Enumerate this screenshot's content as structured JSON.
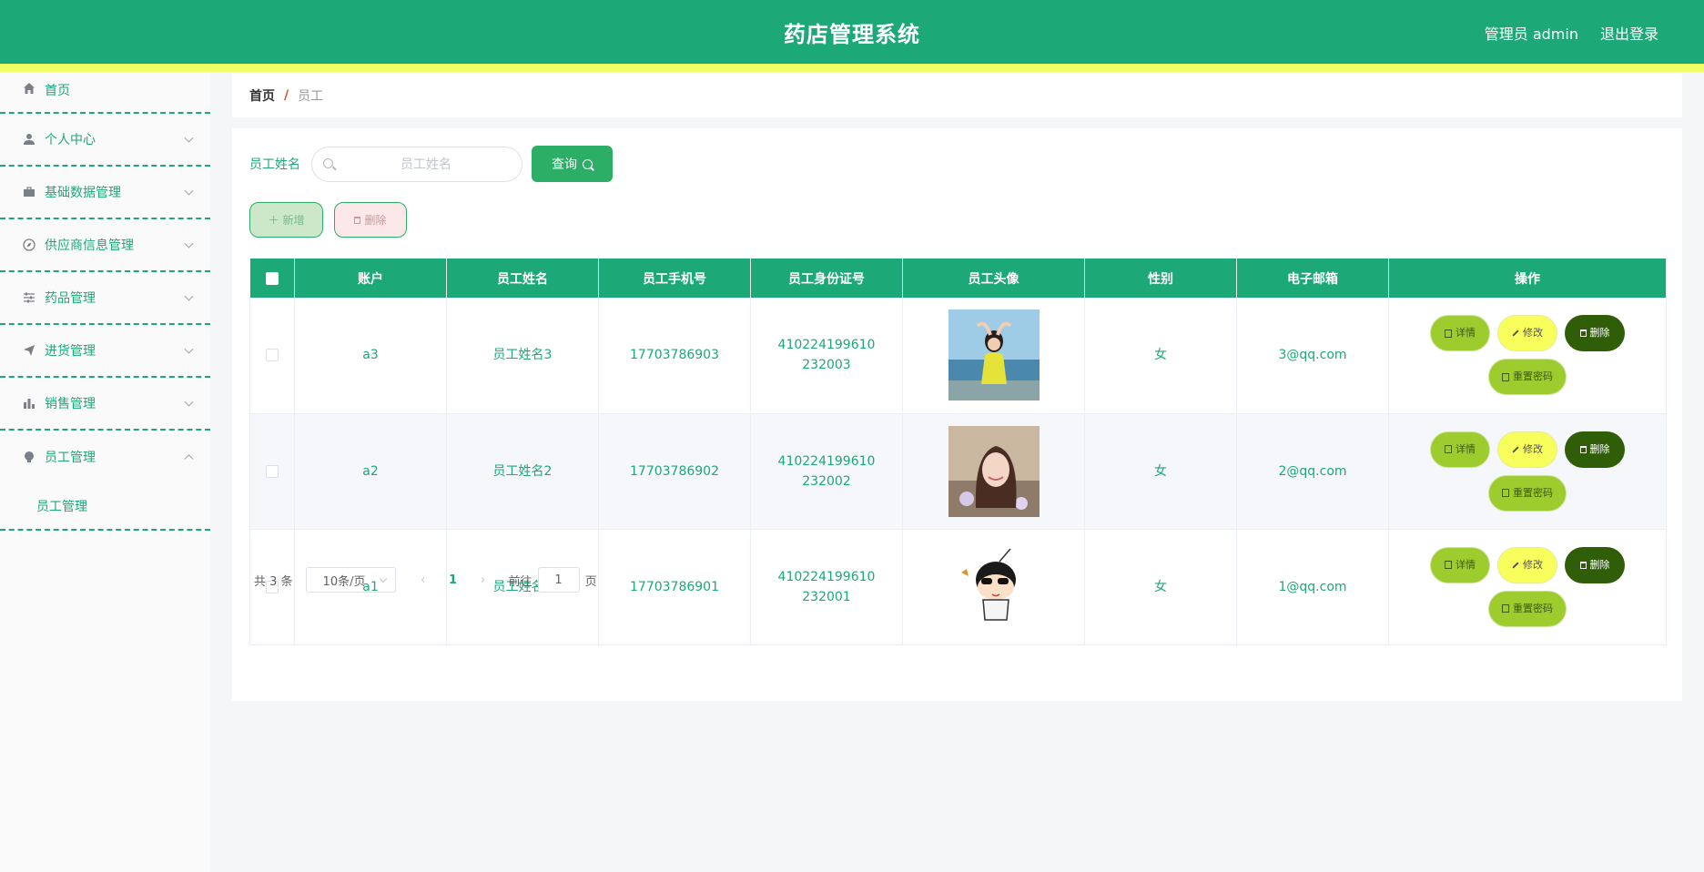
{
  "header": {
    "title": "药店管理系统",
    "user": "管理员 admin",
    "logout": "退出登录"
  },
  "sidebar": {
    "items": [
      {
        "label": "首页",
        "icon": "home-icon"
      },
      {
        "label": "个人中心",
        "icon": "user-icon"
      },
      {
        "label": "基础数据管理",
        "icon": "briefcase-icon"
      },
      {
        "label": "供应商信息管理",
        "icon": "compass-icon"
      },
      {
        "label": "药品管理",
        "icon": "sliders-icon"
      },
      {
        "label": "进货管理",
        "icon": "send-icon"
      },
      {
        "label": "销售管理",
        "icon": "bar-chart-icon"
      },
      {
        "label": "员工管理",
        "icon": "bulb-icon"
      }
    ],
    "submenu": "员工管理"
  },
  "breadcrumb": {
    "home": "首页",
    "separator": "/",
    "current": "员工"
  },
  "search": {
    "label": "员工姓名",
    "placeholder": "员工姓名",
    "button": "查询"
  },
  "actions": {
    "add": "新增",
    "delete": "删除"
  },
  "table": {
    "headers": [
      "账户",
      "员工姓名",
      "员工手机号",
      "员工身份证号",
      "员工头像",
      "性别",
      "电子邮箱",
      "操作"
    ],
    "rows": [
      {
        "account": "a3",
        "name": "员工姓名3",
        "phone": "17703786903",
        "idno": "410224199610232003",
        "avatar": "photo-girl-yellow",
        "gender": "女",
        "email": "3@qq.com"
      },
      {
        "account": "a2",
        "name": "员工姓名2",
        "phone": "17703786902",
        "idno": "410224199610232002",
        "avatar": "photo-girl-smile",
        "gender": "女",
        "email": "2@qq.com"
      },
      {
        "account": "a1",
        "name": "员工姓名1",
        "phone": "17703786901",
        "idno": "410224199610232001",
        "avatar": "cartoon-boy",
        "gender": "女",
        "email": "1@qq.com"
      }
    ],
    "ops": {
      "detail": "详情",
      "edit": "修改",
      "delete": "删除",
      "reset": "重置密码"
    }
  },
  "pager": {
    "total": "共 3 条",
    "size": "10条/页",
    "current": "1",
    "goto_prefix": "前往",
    "goto_value": "1",
    "goto_suffix": "页"
  },
  "colors": {
    "primary": "#1da878",
    "stripe": "#f0ff66",
    "query": "#2cae66"
  }
}
